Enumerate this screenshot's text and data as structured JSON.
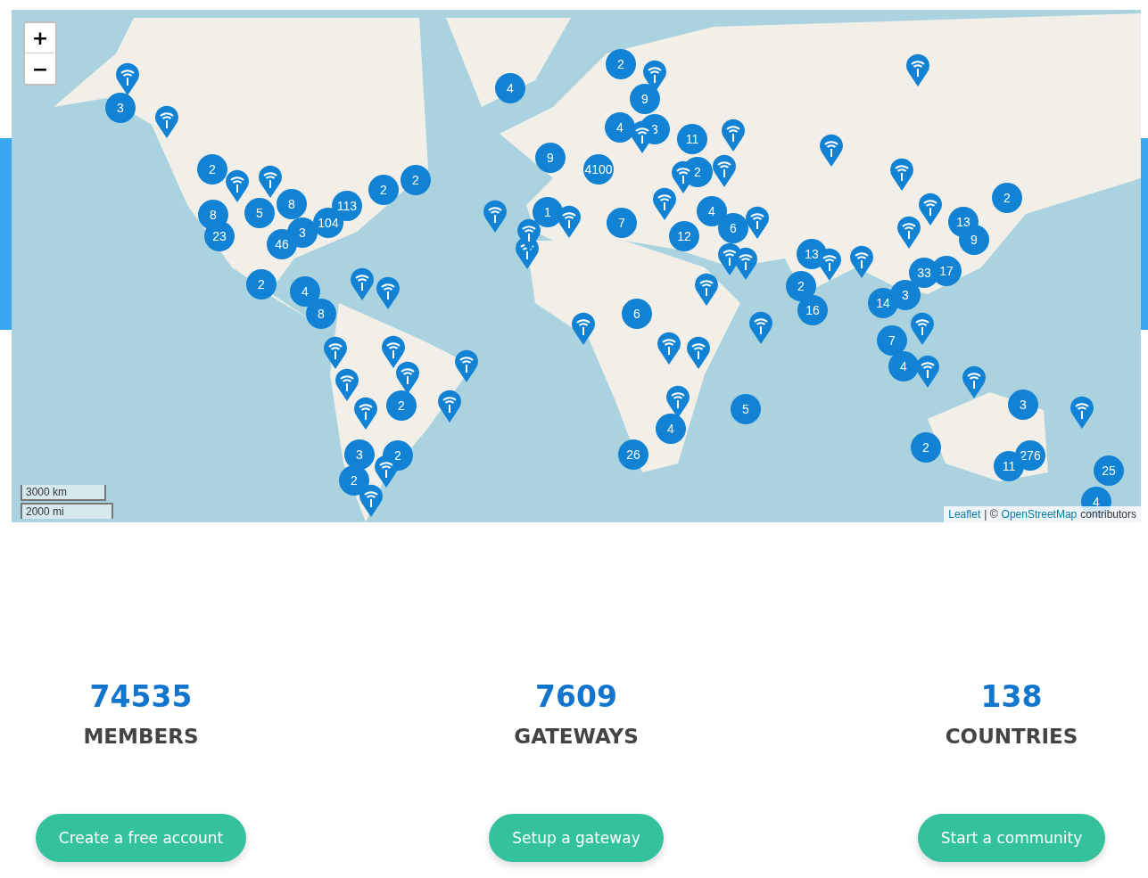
{
  "map": {
    "zoom_in": "+",
    "zoom_out": "−",
    "scale": [
      "3000 km",
      "2000 mi"
    ],
    "attribution": {
      "leaflet": "Leaflet",
      "copyright": "| ©",
      "osm": "OpenStreetMap",
      "suffix": "contributors"
    },
    "clusters": [
      {
        "count": "3"
      },
      {
        "count": "4"
      },
      {
        "count": "2"
      },
      {
        "count": "9"
      },
      {
        "count": "4"
      },
      {
        "count": "3"
      },
      {
        "count": "11"
      },
      {
        "count": "2"
      },
      {
        "count": "2"
      },
      {
        "count": "2"
      },
      {
        "count": "8"
      },
      {
        "count": "23"
      },
      {
        "count": "5"
      },
      {
        "count": "8"
      },
      {
        "count": "113"
      },
      {
        "count": "104"
      },
      {
        "count": "3"
      },
      {
        "count": "46"
      },
      {
        "count": "2"
      },
      {
        "count": "4"
      },
      {
        "count": "8"
      },
      {
        "count": "9"
      },
      {
        "count": "4100"
      },
      {
        "count": "1"
      },
      {
        "count": "7"
      },
      {
        "count": "2"
      },
      {
        "count": "4"
      },
      {
        "count": "6"
      },
      {
        "count": "12"
      },
      {
        "count": "6"
      },
      {
        "count": "2"
      },
      {
        "count": "13"
      },
      {
        "count": "9"
      },
      {
        "count": "13"
      },
      {
        "count": "33"
      },
      {
        "count": "17"
      },
      {
        "count": "2"
      },
      {
        "count": "16"
      },
      {
        "count": "14"
      },
      {
        "count": "3"
      },
      {
        "count": "7"
      },
      {
        "count": "4"
      },
      {
        "count": "5"
      },
      {
        "count": "4"
      },
      {
        "count": "26"
      },
      {
        "count": "3"
      },
      {
        "count": "2"
      },
      {
        "count": "276"
      },
      {
        "count": "11"
      },
      {
        "count": "25"
      },
      {
        "count": "4"
      },
      {
        "count": "2"
      },
      {
        "count": "3"
      },
      {
        "count": "2"
      },
      {
        "count": "2"
      }
    ]
  },
  "stats": [
    {
      "value": "74535",
      "label": "MEMBERS",
      "button": "Create a free account"
    },
    {
      "value": "7609",
      "label": "GATEWAYS",
      "button": "Setup a gateway"
    },
    {
      "value": "138",
      "label": "COUNTRIES",
      "button": "Start a community"
    }
  ]
}
